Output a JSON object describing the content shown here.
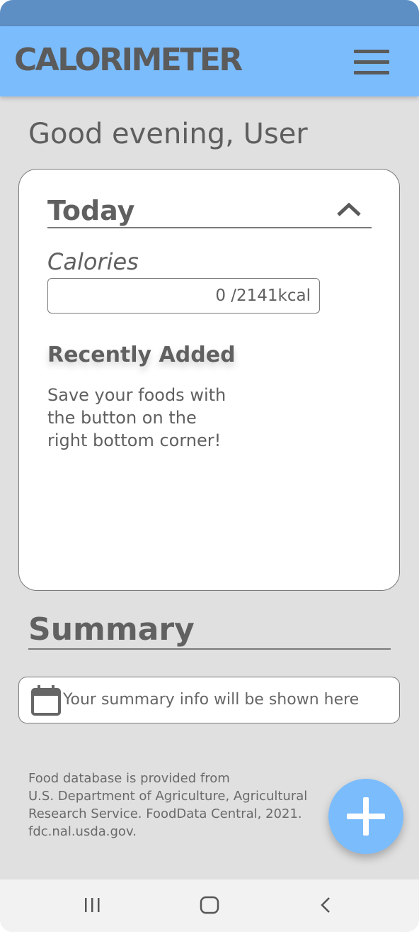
{
  "app": {
    "title": "CALORIMETER",
    "accent_color": "#7bbcfd",
    "status_bar_color": "#5d8fc4",
    "menu_icon": "hamburger-menu-icon"
  },
  "greeting": "Good evening, User",
  "today": {
    "title": "Today",
    "collapse_icon": "chevron-up-icon",
    "calories_label": "Calories",
    "calories_value": "0 /2141kcal",
    "recent_title": "Recently Added",
    "recent_empty_text": "Save your foods with the button on the right bottom corner!"
  },
  "summary": {
    "title": "Summary",
    "icon": "calendar-icon",
    "placeholder_text": "Your summary info will be shown here"
  },
  "footer": {
    "credit_lines": [
      "Food database is provided from",
      "U.S. Department of Agriculture, Agricultural",
      "Research Service. FoodData Central, 2021.",
      "fdc.nal.usda.gov."
    ]
  },
  "fab": {
    "icon": "plus-icon",
    "color": "#7bbcfd"
  },
  "system_nav": {
    "recents_icon": "recent-apps-icon",
    "home_icon": "home-icon",
    "back_icon": "back-icon"
  }
}
